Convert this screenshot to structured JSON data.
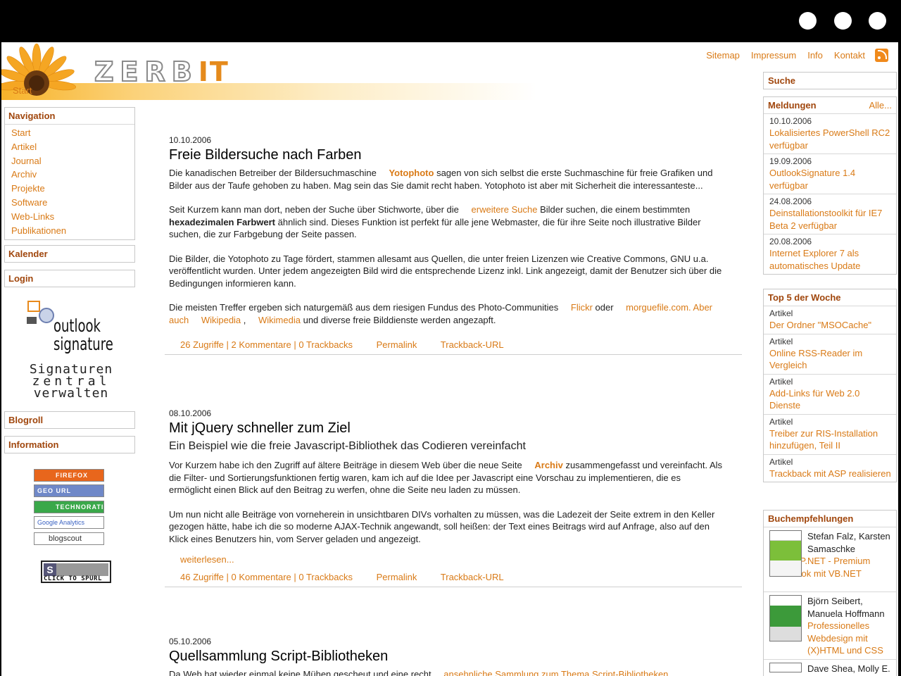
{
  "window": {
    "controls": [
      "window-dot-1",
      "window-dot-2",
      "window-dot-3"
    ]
  },
  "header": {
    "logo_text": "ZERB",
    "logo_suffix": "IT",
    "breadcrumb": "Start",
    "links": {
      "sitemap": "Sitemap",
      "impressum": "Impressum",
      "info": "Info",
      "kontakt": "Kontakt"
    },
    "rss_icon": "rss-icon"
  },
  "left_sidebar": {
    "navigation": {
      "title": "Navigation",
      "items": [
        "Start",
        "Artikel",
        "Journal",
        "Archiv",
        "Projekte",
        "Software",
        "Web-Links",
        "Publikationen"
      ]
    },
    "kalender": "Kalender",
    "login": "Login",
    "ad": {
      "line1": "outlook",
      "line2": "signature",
      "line3": "Signaturen",
      "line4": "zentral",
      "line5": "verwalten"
    },
    "blogroll": "Blogroll",
    "information": "Information",
    "badges": {
      "firefox": "FIREFOX",
      "geourl": "GEO URL",
      "technorati": "TECHNORATI",
      "google": "Google Analytics",
      "blogscout": "blogscout"
    },
    "spurl": "CLICK TO SPURL"
  },
  "posts": [
    {
      "date": "10.10.2006",
      "title": "Freie Bildersuche nach Farben",
      "p1": {
        "a": "Die kanadischen Betreiber der Bildersuchmaschine ",
        "link": "Yotophoto",
        "b": " sagen von sich selbst die erste Suchmaschine für freie Grafiken und Bilder aus der Taufe gehoben zu haben. Mag sein das Sie damit recht haben. Yotophoto ist aber mit Sicherheit die interessanteste..."
      },
      "p2": {
        "a": "Seit Kurzem kann man dort, neben der Suche über Stichworte, über die ",
        "link": "erweitere Suche",
        "b": " Bilder suchen, die einem bestimmten ",
        "bold": "hexadezimalen Farbwert",
        "c": " ähnlich sind. Dieses Funktion ist perfekt für alle jene Webmaster, die für ihre Seite noch illustrative Bilder suchen, die zur Farbgebung der Seite passen."
      },
      "p3": "Die Bilder, die Yotophoto zu Tage fördert, stammen allesamt aus Quellen, die unter freien Lizenzen wie Creative Commons, GNU u.a. veröffentlicht wurden. Unter jedem angezeigten Bild wird die entsprechende Lizenz inkl. Link angezeigt, damit der Benutzer sich über die Bedingungen informieren kann.",
      "p4": {
        "a": "Die meisten Treffer ergeben sich naturgemäß aus dem riesigen Fundus des Photo-Communities ",
        "flickr": "Flickr",
        "b": " oder ",
        "morguefile": "morguefile.com",
        "c": ". Aber auch ",
        "wikipedia": "Wikipedia",
        "d": " , ",
        "wikimedia": "Wikimedia",
        "e": " und diverse freie Bilddienste werden angezapft."
      },
      "footer": {
        "stats": "26 Zugriffe | 2 Kommentare | 0 Trackbacks",
        "permalink": "Permalink",
        "trackback": "Trackback-URL"
      }
    },
    {
      "date": "08.10.2006",
      "title": "Mit jQuery schneller zum Ziel",
      "subtitle": "Ein Beispiel wie die freie Javascript-Bibliothek das Codieren vereinfacht",
      "p1": {
        "a": "Vor Kurzem habe ich den Zugriff auf ältere Beiträge in diesem Web über die neue Seite ",
        "link": "Archiv",
        "b": " zusammengefasst und vereinfacht. Als die Filter- und Sortierungsfunktionen fertig waren, kam ich auf die Idee per Javascript eine Vorschau zu implementieren, die es ermöglicht einen Blick auf den Beitrag zu werfen, ohne die Seite neu laden zu müssen."
      },
      "p2": "Um nun nicht alle Beiträge von vorneherein in unsichtbaren DIVs vorhalten zu müssen, was die Ladezeit der Seite extrem in den Keller gezogen hätte, habe ich die so moderne AJAX-Technik angewandt, soll heißen: der Text eines Beitrags wird auf Anfrage, also auf den Klick eines Benutzers hin, vom Server geladen und angezeigt.",
      "more": "weiterlesen...",
      "footer": {
        "stats": "46 Zugriffe | 0 Kommentare | 0 Trackbacks",
        "permalink": "Permalink",
        "trackback": "Trackback-URL"
      }
    },
    {
      "date": "05.10.2006",
      "title": "Quellsammlung Script-Bibliotheken",
      "p1": {
        "a": "Da Web hat wieder einmal keine Mühen gescheut und eine recht ",
        "link": "ansehnliche Sammlung zum Thema Script-Bibliotheken"
      }
    }
  ],
  "right_sidebar": {
    "suche": "Suche",
    "meldungen": {
      "title": "Meldungen",
      "more": "Alle...",
      "items": [
        {
          "date": "10.10.2006",
          "title": "Lokalisiertes PowerShell RC2 verfügbar"
        },
        {
          "date": "19.09.2006",
          "title": "OutlookSignature 1.4 verfügbar"
        },
        {
          "date": "24.08.2006",
          "title": "Deinstallationstoolkit für IE7 Beta 2 verfügbar"
        },
        {
          "date": "20.08.2006",
          "title": "Internet Explorer 7 als automatisches Update"
        }
      ]
    },
    "top5": {
      "title": "Top 5 der Woche",
      "items": [
        {
          "type": "Artikel",
          "title": "Der Ordner \"MSOCache\""
        },
        {
          "type": "Artikel",
          "title": "Online RSS-Reader im Vergleich"
        },
        {
          "type": "Artikel",
          "title": "Add-Links für Web 2.0 Dienste"
        },
        {
          "type": "Artikel",
          "title": "Treiber zur RIS-Installation hinzufügen, Teil II"
        },
        {
          "type": "Artikel",
          "title": "Trackback mit ASP realisieren"
        }
      ]
    },
    "buch": {
      "title": "Buchempfehlungen",
      "items": [
        {
          "authors": "Stefan Falz, Karsten Samaschke",
          "title": "Das ASP.NET - Premium Codebook mit VB.NET"
        },
        {
          "authors": "Björn Seibert, Manuela Hoffmann",
          "title": "Professionelles Webdesign mit (X)HTML und CSS"
        },
        {
          "authors": "Dave Shea, Molly E.",
          "title": ""
        }
      ]
    }
  }
}
